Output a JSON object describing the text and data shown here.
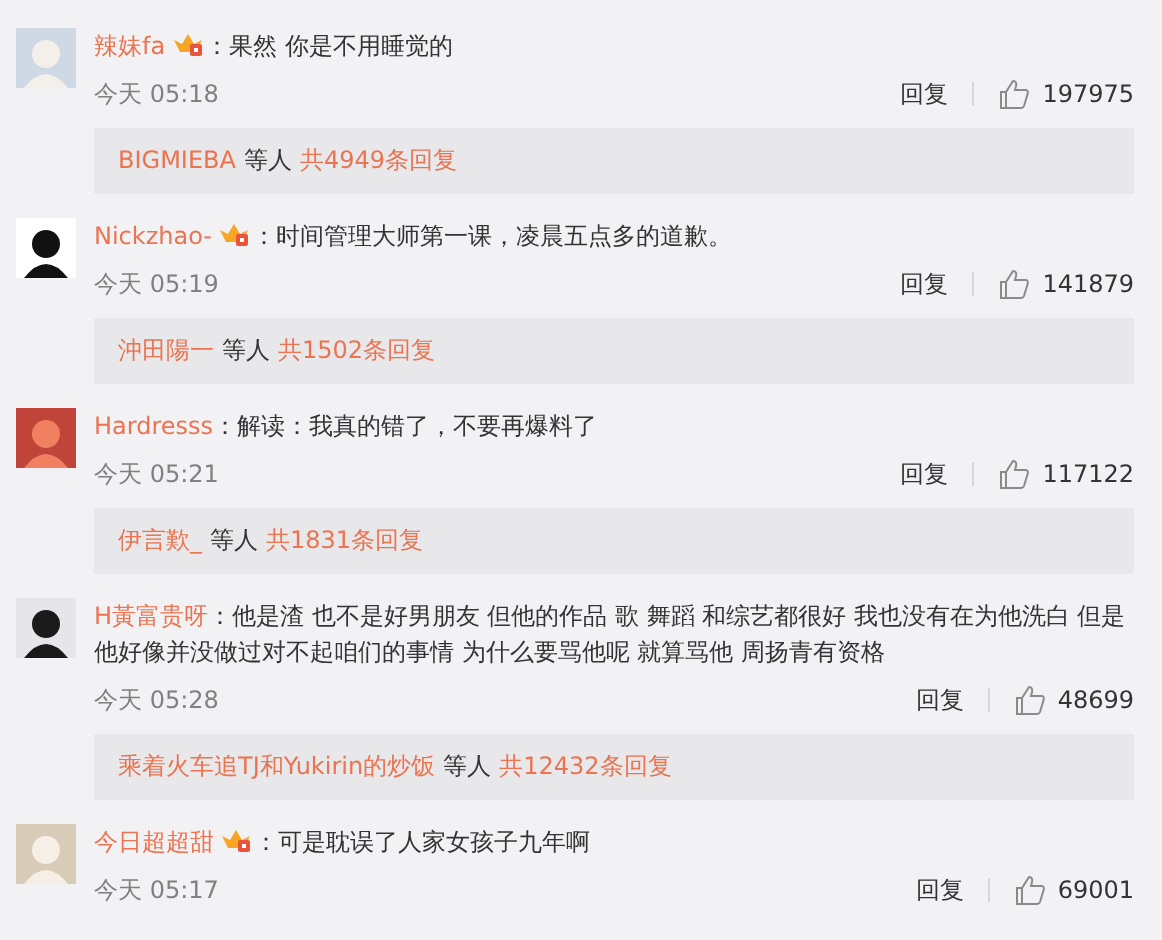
{
  "comments": [
    {
      "user": "辣妹fa",
      "badge": true,
      "text": "：果然 你是不用睡觉的",
      "time": "今天 05:18",
      "reply_label": "回复",
      "likes": "197975",
      "replies": {
        "users": "BIGMIEBA",
        "suffix": "等人",
        "count": "共4949条回复"
      }
    },
    {
      "user": "Nickzhao-",
      "badge": true,
      "text": "：时间管理大师第一课，凌晨五点多的道歉。",
      "time": "今天 05:19",
      "reply_label": "回复",
      "likes": "141879",
      "replies": {
        "users": "沖田陽一",
        "suffix": "等人",
        "count": "共1502条回复"
      }
    },
    {
      "user": "Hardresss",
      "badge": false,
      "text": "：解读：我真的错了，不要再爆料了",
      "time": "今天 05:21",
      "reply_label": "回复",
      "likes": "117122",
      "replies": {
        "users": "伊言歎_",
        "suffix": "等人",
        "count": "共1831条回复"
      }
    },
    {
      "user": "H黃富贵呀",
      "badge": false,
      "text": "：他是渣 也不是好男朋友 但他的作品 歌 舞蹈 和综艺都很好 我也没有在为他洗白 但是他好像并没做过对不起咱们的事情 为什么要骂他呢 就算骂他 周扬青有资格",
      "time": "今天 05:28",
      "reply_label": "回复",
      "likes": "48699",
      "replies": {
        "users": "乘着火车追TJ和Yukirin的炒饭",
        "suffix": "等人",
        "count": "共12432条回复"
      }
    },
    {
      "user": "今日超超甜",
      "badge": true,
      "text": "：可是耽误了人家女孩子九年啊",
      "time": "今天 05:17",
      "reply_label": "回复",
      "likes": "69001"
    }
  ]
}
